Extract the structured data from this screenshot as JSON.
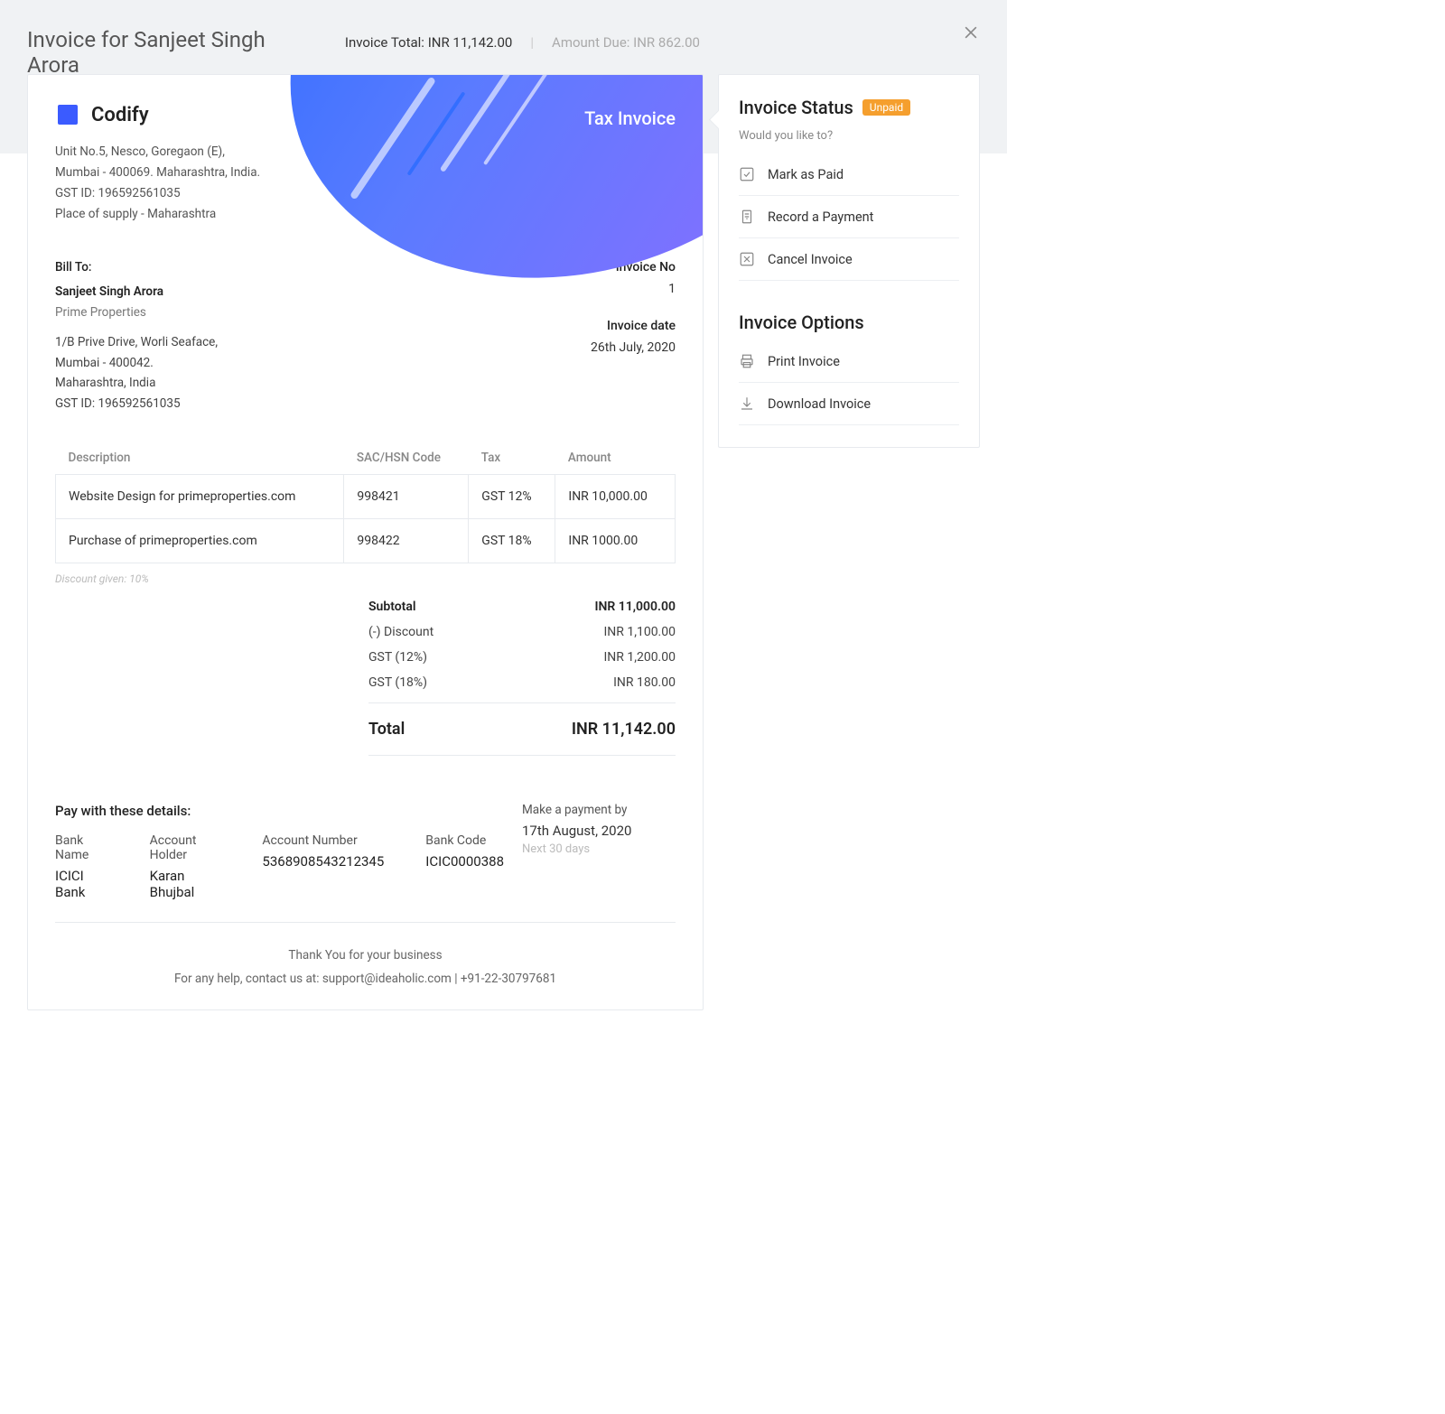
{
  "header": {
    "title": "Invoice for Sanjeet Singh Arora",
    "invoice_total_label": "Invoice Total:",
    "invoice_total_value": "INR 11,142.00",
    "amount_due_label": "Amount Due:",
    "amount_due_value": "INR 862.00"
  },
  "brand": {
    "name": "Codify"
  },
  "document": {
    "type_label": "Tax Invoice"
  },
  "seller": {
    "line1": "Unit No.5, Nesco, Goregaon (E),",
    "line2": "Mumbai - 400069. Maharashtra, India.",
    "gst": "GST ID: 196592561035",
    "supply": "Place of supply - Maharashtra"
  },
  "bill_to": {
    "label": "Bill To:",
    "name": "Sanjeet Singh Arora",
    "company": "Prime Properties",
    "addr1": "1/B Prive Drive, Worli Seaface,",
    "addr2": "Mumbai - 400042.",
    "addr3": "Maharashtra, India",
    "gst": "GST ID: 196592561035"
  },
  "meta": {
    "invoice_no_label": "Invoice No",
    "invoice_no": "1",
    "invoice_date_label": "Invoice date",
    "invoice_date": "26th July, 2020"
  },
  "columns": {
    "desc": "Description",
    "code": "SAC/HSN Code",
    "tax": "Tax",
    "amount": "Amount"
  },
  "items": [
    {
      "desc": "Website Design for primeproperties.com",
      "code": "998421",
      "tax": "GST 12%",
      "amount": "INR 10,000.00"
    },
    {
      "desc": "Purchase of primeproperties.com",
      "code": "998422",
      "tax": "GST 18%",
      "amount": "INR 1000.00"
    }
  ],
  "discount_note": "Discount given: 10%",
  "totals": {
    "subtotal_label": "Subtotal",
    "subtotal": "INR 11,000.00",
    "discount_label": "(-) Discount",
    "discount": "INR 1,100.00",
    "gst12_label": "GST (12%)",
    "gst12": "INR 1,200.00",
    "gst18_label": "GST (18%)",
    "gst18": "INR 180.00",
    "total_label": "Total",
    "total": "INR 11,142.00"
  },
  "payment": {
    "title": "Pay with these details:",
    "bank_name_label": "Bank Name",
    "bank_name": "ICICI Bank",
    "holder_label": "Account Holder",
    "holder": "Karan Bhujbal",
    "account_label": "Account Number",
    "account": "5368908543212345",
    "code_label": "Bank Code",
    "code": "ICIC0000388",
    "due_label": "Make a payment by",
    "due_date": "17th August, 2020",
    "due_window": "Next 30 days"
  },
  "footer": {
    "thanks": "Thank You for your business",
    "help": "For any help, contact us at: support@ideaholic.com | +91-22-30797681"
  },
  "sidebar": {
    "status_title": "Invoice Status",
    "status_badge": "Unpaid",
    "prompt": "Would you like to?",
    "actions": {
      "mark_paid": "Mark as Paid",
      "record_payment": "Record a Payment",
      "cancel": "Cancel Invoice"
    },
    "options_title": "Invoice Options",
    "options": {
      "print": "Print Invoice",
      "download": "Download Invoice"
    }
  }
}
